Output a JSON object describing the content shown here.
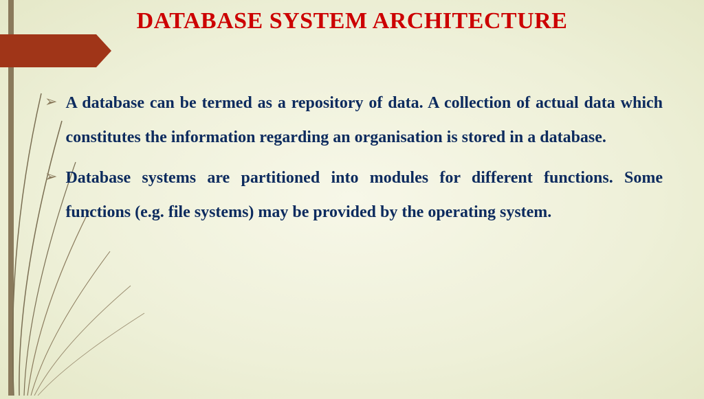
{
  "title": "DATABASE SYSTEM ARCHITECTURE",
  "bullets": [
    {
      "text": "A database can be termed as a repository of data. A collection of actual data which constitutes the information regarding an organisation is stored in a database."
    },
    {
      "text": "Database systems are partitioned into modules for different functions. Some functions (e.g. file systems) may be provided by the operating system."
    }
  ]
}
